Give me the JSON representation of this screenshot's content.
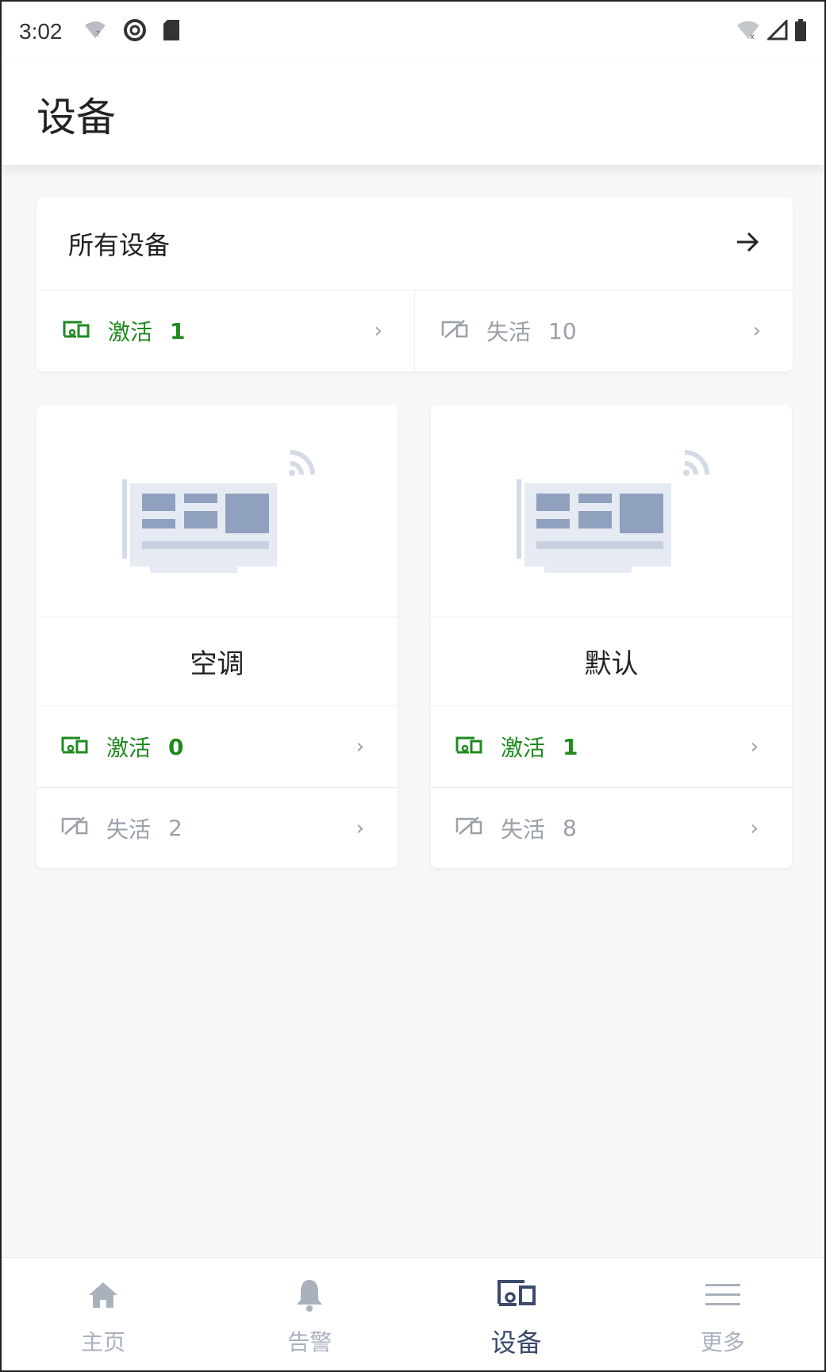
{
  "status_bar": {
    "time": "3:02"
  },
  "header": {
    "title": "设备"
  },
  "all_devices": {
    "label": "所有设备",
    "active": {
      "label": "激活",
      "count": "1"
    },
    "inactive": {
      "label": "失活",
      "count": "10"
    }
  },
  "groups": [
    {
      "name": "空调",
      "active": {
        "label": "激活",
        "count": "0"
      },
      "inactive": {
        "label": "失活",
        "count": "2"
      }
    },
    {
      "name": "默认",
      "active": {
        "label": "激活",
        "count": "1"
      },
      "inactive": {
        "label": "失活",
        "count": "8"
      }
    }
  ],
  "bottom_nav": {
    "items": [
      {
        "label": "主页",
        "icon": "home-icon"
      },
      {
        "label": "告警",
        "icon": "bell-icon"
      },
      {
        "label": "设备",
        "icon": "devices-icon",
        "selected": true
      },
      {
        "label": "更多",
        "icon": "menu-icon"
      }
    ]
  },
  "colors": {
    "active": "#1f8a1f",
    "inactive": "#9aa0a8",
    "nav_selected": "#3b4a6b",
    "nav_idle": "#a9b1bd"
  }
}
